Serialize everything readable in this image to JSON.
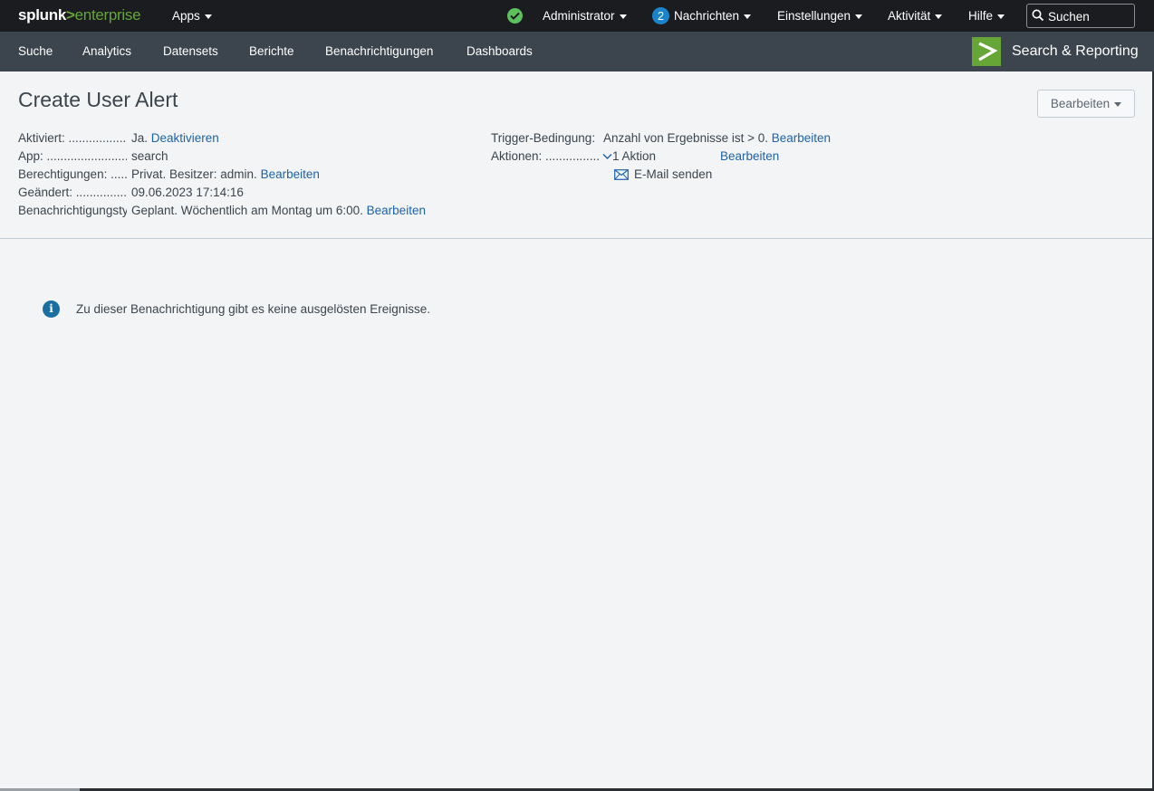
{
  "topbar": {
    "logo_splunk": "splunk",
    "logo_gt": ">",
    "logo_enterprise": "enterprise",
    "apps_label": "Apps",
    "admin_label": "Administrator",
    "messages_count": "2",
    "messages_label": "Nachrichten",
    "settings_label": "Einstellungen",
    "activity_label": "Aktivität",
    "help_label": "Hilfe",
    "search_placeholder": "Suchen"
  },
  "appnav": {
    "items": [
      "Suche",
      "Analytics",
      "Datensets",
      "Berichte",
      "Benachrichtigungen",
      "Dashboards"
    ],
    "app_title": "Search & Reporting",
    "app_logo_glyph": ">"
  },
  "alert": {
    "title": "Create User Alert",
    "edit_button": "Bearbeiten",
    "fields_left": [
      {
        "label": "Aktiviert: ...................",
        "value": "Ja.",
        "link": "Deaktivieren"
      },
      {
        "label": "App: ...........................",
        "value": "search",
        "link": ""
      },
      {
        "label": "Berechtigungen: .....",
        "value": "Privat. Besitzer: admin.",
        "link": "Bearbeiten"
      },
      {
        "label": "Geändert: .................",
        "value": "09.06.2023 17:14:16",
        "link": ""
      },
      {
        "label": "Benachrichtigungstyp",
        "value": "Geplant. Wöchentlich am Montag um 6:00.",
        "link": "Bearbeiten"
      }
    ],
    "trigger_label": "Trigger-Bedingung:",
    "trigger_value": "Anzahl von Ergebnisse ist > 0.",
    "trigger_link": "Bearbeiten",
    "actions_label": "Aktionen: .................",
    "actions_value": "1 Aktion",
    "actions_link": "Bearbeiten",
    "action_item": "E-Mail senden"
  },
  "info": {
    "icon": "i",
    "message": "Zu dieser Benachrichtigung gibt es keine ausgelösten Ereignisse."
  },
  "colors": {
    "topbar_bg": "#1a1c20",
    "appbar_bg": "#3c444d",
    "brand_green": "#65a637",
    "link": "#1e62a8",
    "page_bg": "#f2f4f5"
  }
}
